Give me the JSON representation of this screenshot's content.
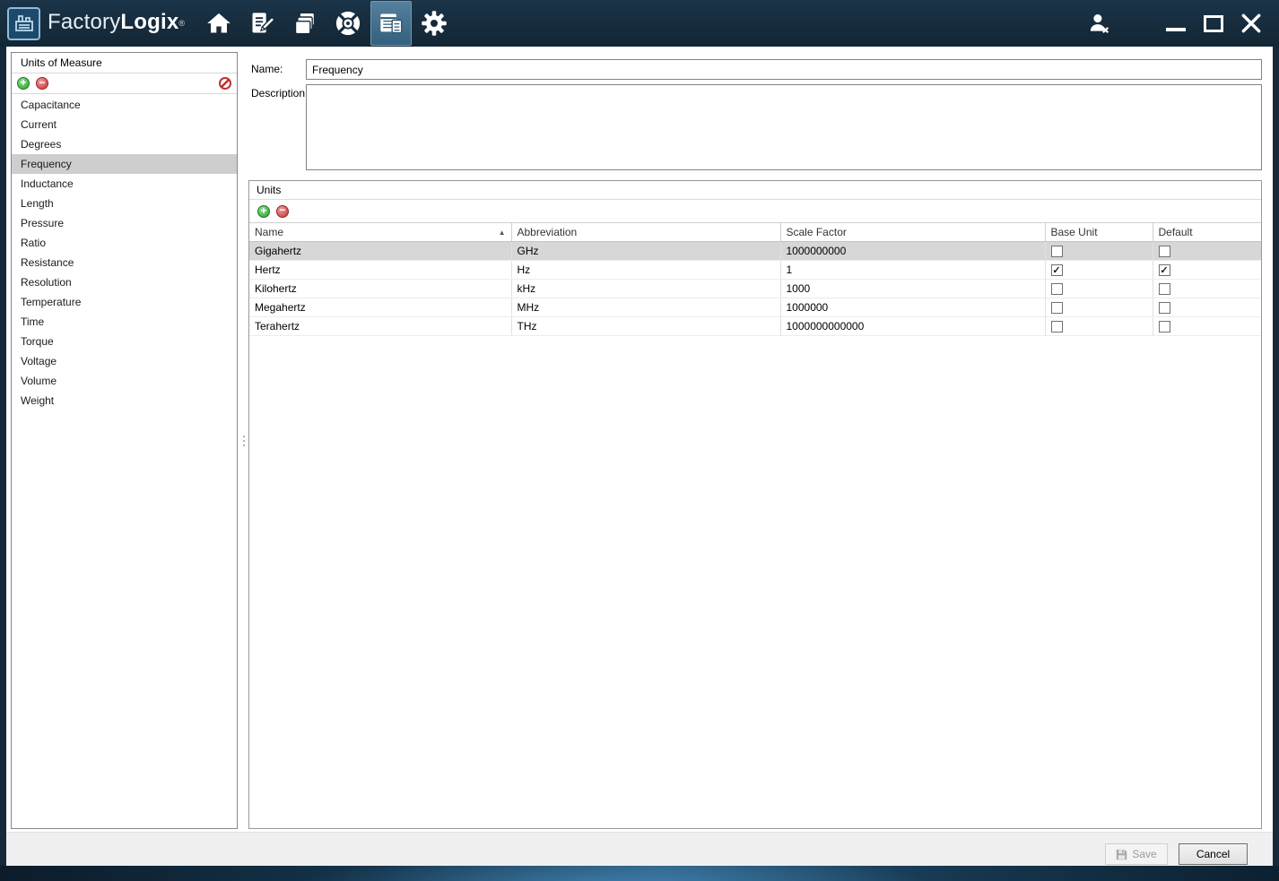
{
  "window": {
    "brand_light": "Factory",
    "brand_bold": "Logix",
    "trademark": "®"
  },
  "titlebar": {
    "icons": [
      {
        "name": "home-icon"
      },
      {
        "name": "edit-document-icon"
      },
      {
        "name": "documents-stack-icon"
      },
      {
        "name": "compass-icon"
      },
      {
        "name": "forms-icon",
        "active": true
      },
      {
        "name": "settings-gear-icon"
      }
    ],
    "window_controls": [
      "logoff-user-icon",
      "minimize-button",
      "maximize-button",
      "close-button"
    ]
  },
  "sidebar": {
    "title": "Units of Measure",
    "toolbar": [
      "add-icon",
      "remove-icon",
      "cancel-circle-icon"
    ],
    "items": [
      {
        "label": "Capacitance",
        "selected": false
      },
      {
        "label": "Current",
        "selected": false
      },
      {
        "label": "Degrees",
        "selected": false
      },
      {
        "label": "Frequency",
        "selected": true
      },
      {
        "label": "Inductance",
        "selected": false
      },
      {
        "label": "Length",
        "selected": false
      },
      {
        "label": "Pressure",
        "selected": false
      },
      {
        "label": "Ratio",
        "selected": false
      },
      {
        "label": "Resistance",
        "selected": false
      },
      {
        "label": "Resolution",
        "selected": false
      },
      {
        "label": "Temperature",
        "selected": false
      },
      {
        "label": "Time",
        "selected": false
      },
      {
        "label": "Torque",
        "selected": false
      },
      {
        "label": "Voltage",
        "selected": false
      },
      {
        "label": "Volume",
        "selected": false
      },
      {
        "label": "Weight",
        "selected": false
      }
    ]
  },
  "form": {
    "name_label": "Name:",
    "name_value": "Frequency",
    "description_label": "Description:",
    "description_value": ""
  },
  "units": {
    "title": "Units",
    "toolbar": [
      "add-icon",
      "remove-icon"
    ],
    "columns": [
      "Name",
      "Abbreviation",
      "Scale Factor",
      "Base Unit",
      "Default"
    ],
    "sorted_column": "Name",
    "sort_direction": "ascending",
    "rows": [
      {
        "name": "Gigahertz",
        "abbreviation": "GHz",
        "scale_factor": "1000000000",
        "base_unit": false,
        "default": false,
        "selected": true
      },
      {
        "name": "Hertz",
        "abbreviation": "Hz",
        "scale_factor": "1",
        "base_unit": true,
        "default": true,
        "selected": false
      },
      {
        "name": "Kilohertz",
        "abbreviation": "kHz",
        "scale_factor": "1000",
        "base_unit": false,
        "default": false,
        "selected": false
      },
      {
        "name": "Megahertz",
        "abbreviation": "MHz",
        "scale_factor": "1000000",
        "base_unit": false,
        "default": false,
        "selected": false
      },
      {
        "name": "Terahertz",
        "abbreviation": "THz",
        "scale_factor": "1000000000000",
        "base_unit": false,
        "default": false,
        "selected": false
      }
    ]
  },
  "footer": {
    "save_label": "Save",
    "cancel_label": "Cancel"
  }
}
